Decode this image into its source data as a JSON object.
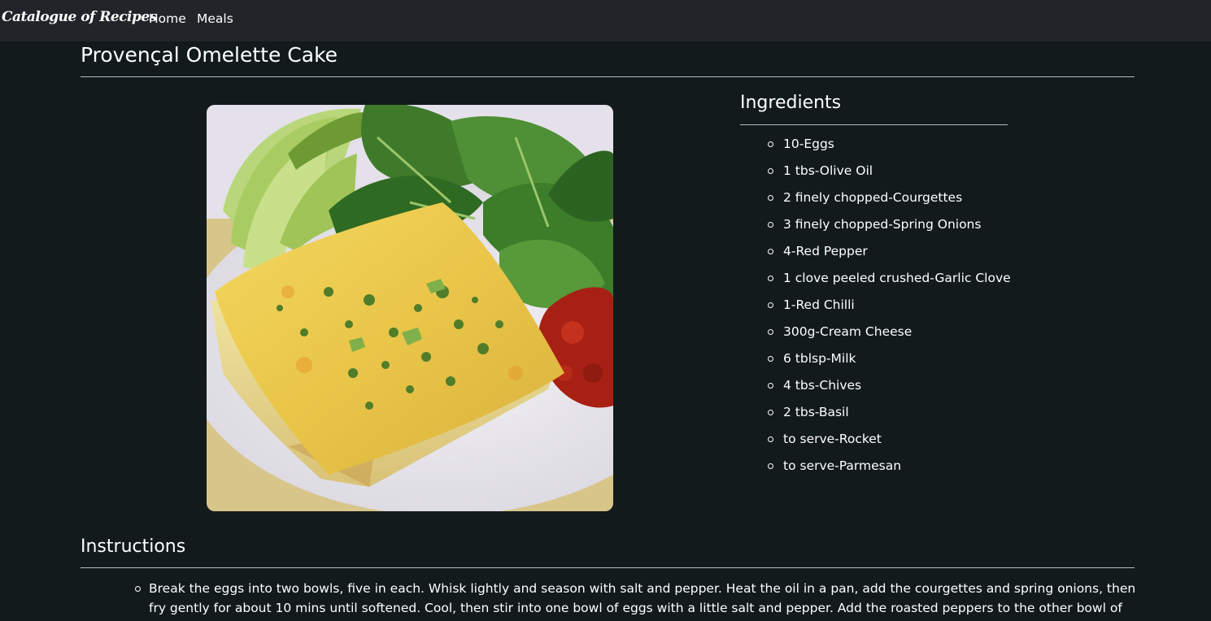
{
  "navbar": {
    "brand": "Catalogue of Recipes",
    "links": [
      "Home",
      "Meals"
    ]
  },
  "meal": {
    "title": "Provençal Omelette Cake",
    "image_alt": "Provençal Omelette Cake"
  },
  "ingredients": {
    "heading": "Ingredients",
    "items": [
      "10-Eggs",
      "1 tbs-Olive Oil",
      "2 finely chopped-Courgettes",
      "3 finely chopped-Spring Onions",
      "4-Red Pepper",
      "1 clove peeled crushed-Garlic Clove",
      "1-Red Chilli",
      "300g-Cream Cheese",
      "6 tblsp-Milk",
      "4 tbs-Chives",
      "2 tbs-Basil",
      "to serve-Rocket",
      "to serve-Parmesan"
    ]
  },
  "instructions": {
    "heading": "Instructions",
    "steps": [
      "Break the eggs into two bowls, five in each. Whisk lightly and season with salt and pepper. Heat the oil in a pan, add the courgettes and spring onions, then fry gently for about 10 mins until softened. Cool, then stir into one bowl of eggs with a little salt and pepper. Add the roasted peppers to the other bowl of"
    ]
  }
}
